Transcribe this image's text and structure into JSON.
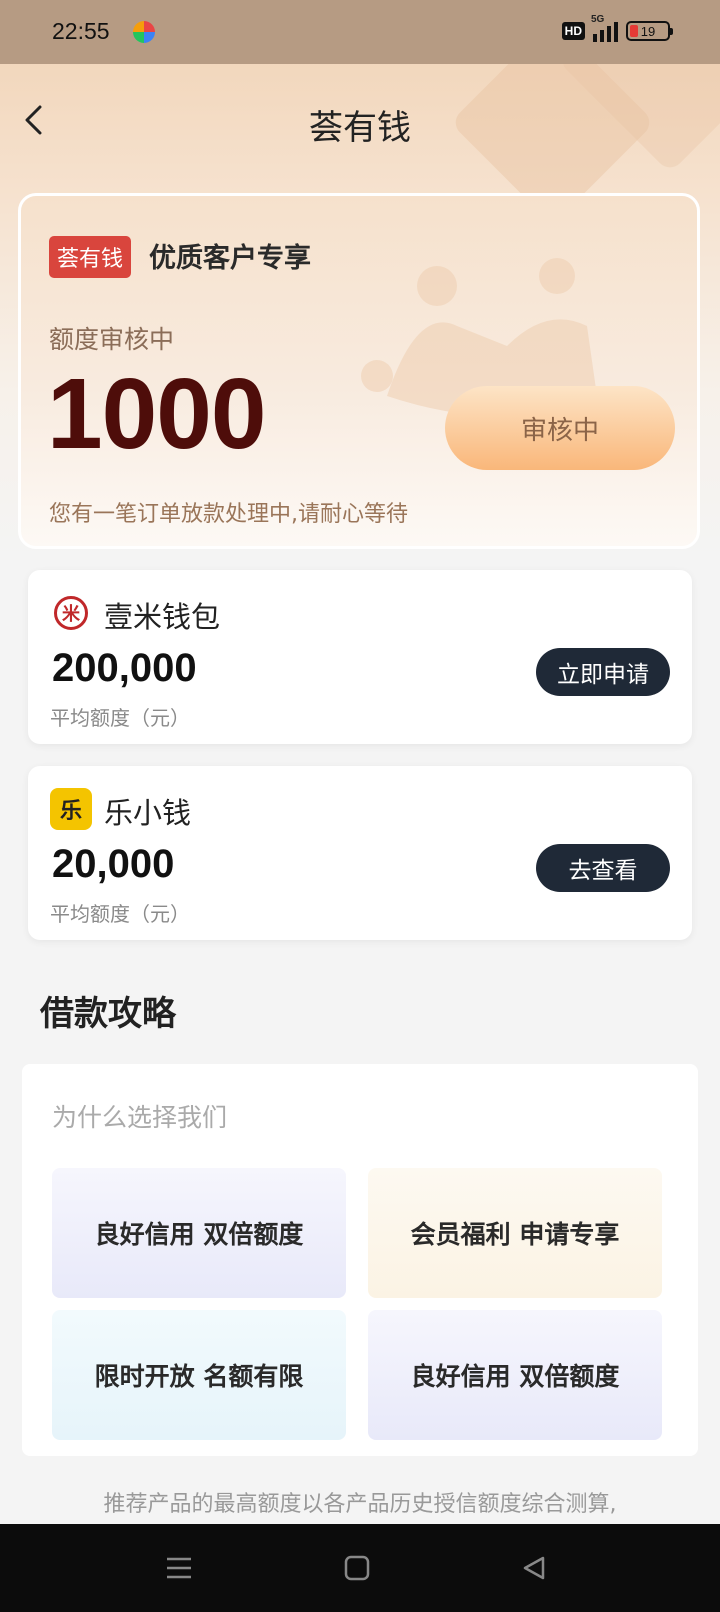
{
  "status_bar": {
    "time": "22:55",
    "network": "5G",
    "hd": "HD",
    "battery": "19"
  },
  "header": {
    "title": "荟有钱"
  },
  "hero": {
    "brand_tag": "荟有钱",
    "subtitle": "优质客户专享",
    "status_label": "额度审核中",
    "amount": "1000",
    "button_label": "审核中",
    "note": "您有一笔订单放款处理中,请耐心等待"
  },
  "products": [
    {
      "name": "壹米钱包",
      "amount": "200,000",
      "caption": "平均额度（元）",
      "button": "立即申请",
      "logo_char": "米",
      "logo_color": "#c0282a"
    },
    {
      "name": "乐小钱",
      "amount": "20,000",
      "caption": "平均额度（元）",
      "button": "去查看",
      "logo_char": "乐",
      "logo_color": "#f4c400"
    }
  ],
  "strategy": {
    "title": "借款攻略",
    "prompt": "为什么选择我们",
    "features": [
      "良好信用 双倍额度",
      "会员福利 申请专享",
      "限时开放 名额有限",
      "良好信用 双倍额度"
    ]
  },
  "disclaimer": "推荐产品的最高额度以各产品历史授信额度综合测算,",
  "nav": {
    "icons": [
      "menu-icon",
      "home-icon",
      "back-triangle-icon"
    ]
  }
}
